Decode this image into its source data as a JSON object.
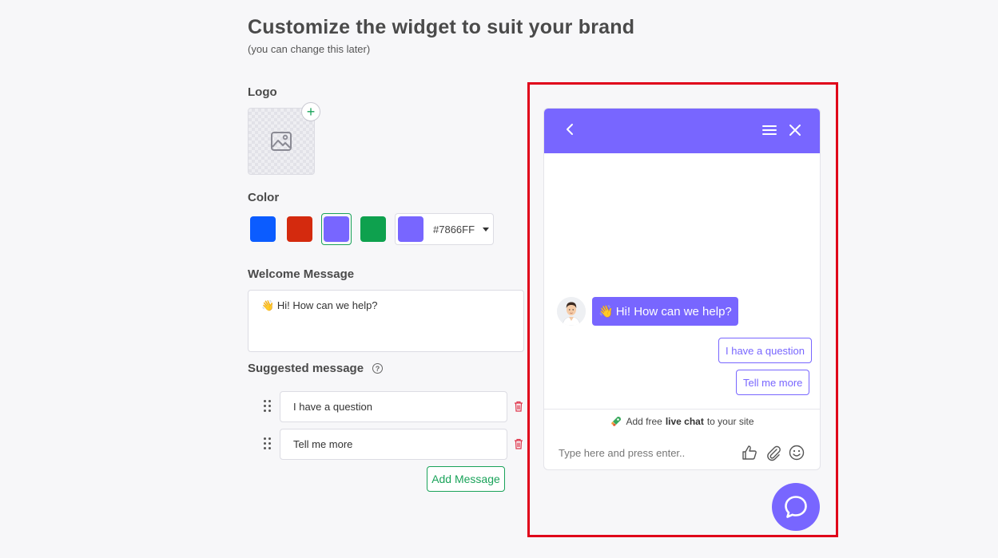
{
  "page": {
    "title": "Customize the widget to suit your brand",
    "subtitle": "(you can change this later)"
  },
  "logo": {
    "label": "Logo",
    "add_symbol": "+"
  },
  "color": {
    "label": "Color",
    "swatches": [
      "#0B5CFF",
      "#D42A0E",
      "#7866FF",
      "#0EA14E"
    ],
    "selected_index": 2,
    "selected_hex": "#7866FF"
  },
  "welcome": {
    "label": "Welcome Message",
    "emoji": "👋",
    "message": "Hi! How can we help?"
  },
  "suggested": {
    "label": "Suggested message",
    "help_symbol": "?",
    "items": [
      "I have a question",
      "Tell me more"
    ],
    "add_label": "Add Message"
  },
  "widget": {
    "accent": "#7866FF",
    "greeting_emoji": "👋",
    "greeting": "Hi! How can we help?",
    "options": [
      "I have a question",
      "Tell me more"
    ],
    "powered": {
      "prefix": "Add free",
      "strong": "live chat",
      "suffix": "to your site"
    },
    "composer_placeholder": "Type here and press enter.."
  }
}
